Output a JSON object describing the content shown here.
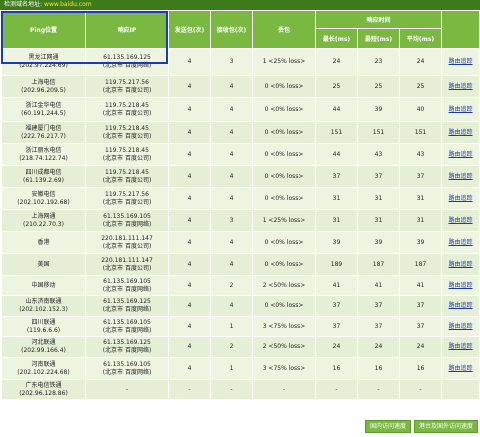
{
  "topbar": {
    "label": "检测域名地址:",
    "domain": "www.baidu.com"
  },
  "headers": {
    "location": "Ping位置",
    "ip": "响应IP",
    "sent": "发送包(次)",
    "received": "接收包(次)",
    "loss": "丢包",
    "resp_time": "响应时间",
    "min": "最长(ms)",
    "max": "最短(ms)",
    "avg": "平均(ms)"
  },
  "rows": [
    {
      "loc1": "黑龙江网通",
      "loc2": "(202.97.224.69)",
      "ip1": "61.135.169.125",
      "ip2": "(北京市 百度网络)",
      "sent": "4",
      "recv": "3",
      "loss": "1 <25% loss>",
      "max": "24",
      "min": "23",
      "avg": "24",
      "trace": "路由追踪"
    },
    {
      "loc1": "上海电信",
      "loc2": "(202.96.209.5)",
      "ip1": "119.75.217.56",
      "ip2": "(北京市 百度公司)",
      "sent": "4",
      "recv": "4",
      "loss": "0 <0% loss>",
      "max": "25",
      "min": "25",
      "avg": "25",
      "trace": "路由追踪"
    },
    {
      "loc1": "浙江金华电信",
      "loc2": "(60.191.244.5)",
      "ip1": "119.75.218.45",
      "ip2": "(北京市 百度公司)",
      "sent": "4",
      "recv": "4",
      "loss": "0 <0% loss>",
      "max": "44",
      "min": "39",
      "avg": "40",
      "trace": "路由追踪"
    },
    {
      "loc1": "福建厦门电信",
      "loc2": "(222.76.217.7)",
      "ip1": "119.75.218.45",
      "ip2": "(北京市 百度公司)",
      "sent": "4",
      "recv": "4",
      "loss": "0 <0% loss>",
      "max": "151",
      "min": "151",
      "avg": "151",
      "trace": "路由追踪"
    },
    {
      "loc1": "浙江丽水电信",
      "loc2": "(218.74.122.74)",
      "ip1": "119.75.218.45",
      "ip2": "(北京市 百度公司)",
      "sent": "4",
      "recv": "4",
      "loss": "0 <0% loss>",
      "max": "44",
      "min": "43",
      "avg": "43",
      "trace": "路由追踪"
    },
    {
      "loc1": "四川成都电信",
      "loc2": "(61.139.2.69)",
      "ip1": "119.75.218.45",
      "ip2": "(北京市 百度公司)",
      "sent": "4",
      "recv": "4",
      "loss": "0 <0% loss>",
      "max": "37",
      "min": "37",
      "avg": "37",
      "trace": "路由追踪"
    },
    {
      "loc1": "安徽电信",
      "loc2": "(202.102.192.68)",
      "ip1": "119.75.217.56",
      "ip2": "(北京市 百度公司)",
      "sent": "4",
      "recv": "4",
      "loss": "0 <0% loss>",
      "max": "31",
      "min": "31",
      "avg": "31",
      "trace": "路由追踪"
    },
    {
      "loc1": "上海网通",
      "loc2": "(210.22.70.3)",
      "ip1": "61.135.169.105",
      "ip2": "(北京市 百度网络)",
      "sent": "4",
      "recv": "3",
      "loss": "1 <25% loss>",
      "max": "31",
      "min": "31",
      "avg": "31",
      "trace": "路由追踪"
    },
    {
      "loc1": "香港",
      "loc2": "",
      "ip1": "220.181.111.147",
      "ip2": "(北京市 百度公司)",
      "sent": "4",
      "recv": "4",
      "loss": "0 <0% loss>",
      "max": "39",
      "min": "39",
      "avg": "39",
      "trace": "路由追踪"
    },
    {
      "loc1": "美国",
      "loc2": "",
      "ip1": "220.181.111.147",
      "ip2": "(北京市 百度公司)",
      "sent": "4",
      "recv": "4",
      "loss": "0 <0% loss>",
      "max": "189",
      "min": "187",
      "avg": "187",
      "trace": "路由追踪"
    },
    {
      "loc1": "中国移动",
      "loc2": "",
      "ip1": "61.135.169.105",
      "ip2": "(北京市 百度网络)",
      "sent": "4",
      "recv": "2",
      "loss": "2 <50% loss>",
      "max": "41",
      "min": "41",
      "avg": "41",
      "trace": "路由追踪"
    },
    {
      "loc1": "山东济南联通",
      "loc2": "(202.102.152.3)",
      "ip1": "61.135.169.125",
      "ip2": "(北京市 百度网络)",
      "sent": "4",
      "recv": "4",
      "loss": "0 <0% loss>",
      "max": "37",
      "min": "37",
      "avg": "37",
      "trace": "路由追踪"
    },
    {
      "loc1": "四川联通",
      "loc2": "(119.6.6.6)",
      "ip1": "61.135.169.105",
      "ip2": "(北京市 百度网络)",
      "sent": "4",
      "recv": "1",
      "loss": "3 <75% loss>",
      "max": "37",
      "min": "37",
      "avg": "37",
      "trace": "路由追踪"
    },
    {
      "loc1": "河北联通",
      "loc2": "(202.99.166.4)",
      "ip1": "61.135.169.125",
      "ip2": "(北京市 百度网络)",
      "sent": "4",
      "recv": "2",
      "loss": "2 <50% loss>",
      "max": "24",
      "min": "24",
      "avg": "24",
      "trace": "路由追踪"
    },
    {
      "loc1": "河南联通",
      "loc2": "(202.102.224.68)",
      "ip1": "61.135.169.105",
      "ip2": "(北京市 百度网络)",
      "sent": "4",
      "recv": "1",
      "loss": "3 <75% loss>",
      "max": "16",
      "min": "16",
      "avg": "16",
      "trace": "路由追踪"
    },
    {
      "loc1": "广东电信铁通",
      "loc2": "(202.96.128.86)",
      "ip1": "-",
      "ip2": "",
      "sent": "-",
      "recv": "-",
      "loss": "-",
      "max": "-",
      "min": "-",
      "avg": "-",
      "trace": ""
    }
  ],
  "buttons": {
    "domestic": "国内访问速度",
    "international": "港台及国外访问速度"
  },
  "colors": {
    "header_bg": "#7ab842",
    "highlight_border": "#1a3cb8",
    "link": "#1f3aa8"
  }
}
